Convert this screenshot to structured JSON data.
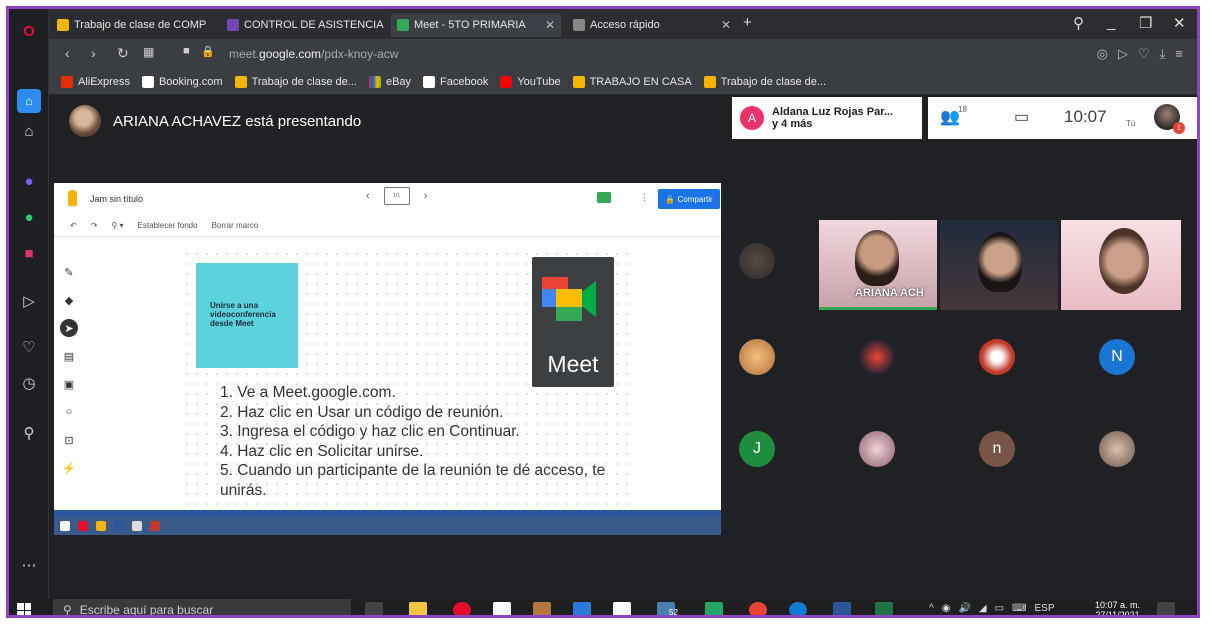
{
  "tabs": [
    {
      "label": "Trabajo de clase de COMP",
      "color": "#f4b400",
      "active": false
    },
    {
      "label": "CONTROL DE ASISTENCIA",
      "color": "#7248b9",
      "active": false
    },
    {
      "label": "Meet - 5TO PRIMARIA",
      "color": "#34a853",
      "active": true
    },
    {
      "label": "Acceso rápido",
      "color": "#888888",
      "active": false
    }
  ],
  "address": {
    "prefix": "meet.",
    "domain": "google.com",
    "path": "/pdx-knoy-acw"
  },
  "bookmarks": [
    "AliExpress",
    "Booking.com",
    "Trabajo de clase de...",
    "eBay",
    "Facebook",
    "YouTube",
    "TRABAJO EN CASA",
    "Trabajo de clase de..."
  ],
  "meet": {
    "presenter_text": "ARIANA ACHAVEZ está presentando",
    "notification": {
      "initial": "A",
      "line1": "Aldana Luz Rojas Par...",
      "line2": "y 4 más"
    },
    "participant_count": "18",
    "time": "10:07",
    "self_label": "Tú",
    "badge": "1"
  },
  "jamboard": {
    "title": "Jam sin título",
    "frame_indicator": "1/1",
    "share_label": "Compartir",
    "tools": [
      "Establecer fondo",
      "Borrar marco"
    ],
    "sticky_note": "Unirse a una videoconferencia desde Meet",
    "meet_logo_word": "Meet",
    "steps": [
      "1.  Ve a Meet.google.com.",
      "2.  Haz clic en Usar un código de reunión.",
      "3.  Ingresa el código y haz clic en Continuar.",
      "4.  Haz clic en Solicitar unirse.",
      "5.  Cuando un participante de la reunión te dé acceso, te unirás."
    ]
  },
  "participants": {
    "video_label": "ARIANA ACH",
    "n_initial": "N",
    "j_initial": "J",
    "n2_initial": "n"
  },
  "colors": {
    "accent_border": "#8e44c4",
    "meet_bg": "#202124",
    "share_blue": "#1a73e8",
    "sticky": "#5cd3dc"
  },
  "taskbar": {
    "search_placeholder": "Escribe aquí para buscar",
    "badge_count": "52",
    "lang": "ESP",
    "time": "10:07 a. m.",
    "date": "27/11/2021"
  }
}
